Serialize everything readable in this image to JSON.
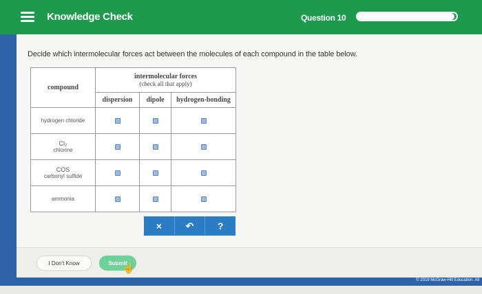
{
  "header": {
    "title": "Knowledge Check",
    "question": "Question 10",
    "progress_fraction": 0.98
  },
  "prompt": "Decide which intermolecular forces act between the molecules of each compound in the table below.",
  "table": {
    "compound_header": "compound",
    "group_title": "intermolecular forces",
    "group_subtitle": "(check all that apply)",
    "columns": [
      "dispersion",
      "dipole",
      "hydrogen-bonding"
    ],
    "rows": [
      {
        "formula": "",
        "name": "hydrogen chloride",
        "checked": [
          false,
          false,
          false
        ]
      },
      {
        "formula": "Cl₂",
        "name": "chlorine",
        "checked": [
          false,
          false,
          false
        ]
      },
      {
        "formula": "COS",
        "name": "carbonyl sulfide",
        "checked": [
          false,
          false,
          false
        ]
      },
      {
        "formula": "",
        "name": "ammonia",
        "checked": [
          false,
          false,
          false
        ]
      }
    ]
  },
  "tools": {
    "clear": "×",
    "undo": "↶",
    "help": "?"
  },
  "footer": {
    "dont_know": "I Don't Know",
    "submit": "Submit",
    "copyright": "© 2019 McGraw-Hill Education. All"
  },
  "colors": {
    "header_green": "#1d9a4c",
    "accent_blue": "#2a7cc4",
    "submit_green": "#6fd19a"
  }
}
